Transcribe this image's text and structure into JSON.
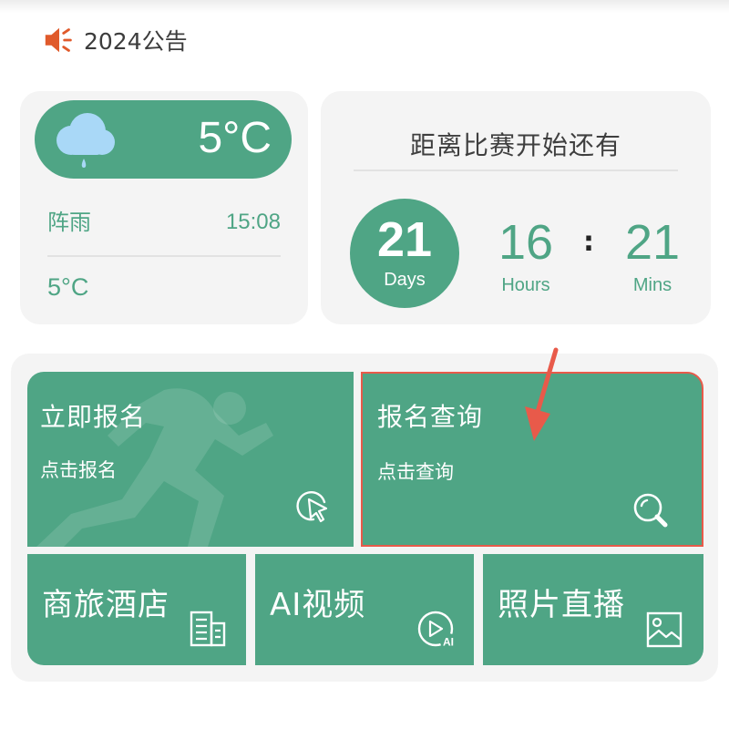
{
  "notice": {
    "text": "2024公告",
    "icon": "speaker-icon"
  },
  "weather": {
    "icon": "cloud-rain-icon",
    "temperature": "5°C",
    "condition": "阵雨",
    "time": "15:08",
    "temperature_secondary": "5°C"
  },
  "countdown": {
    "title": "距离比赛开始还有",
    "days": "21",
    "days_label": "Days",
    "hours": "16",
    "hours_label": "Hours",
    "separator": ":",
    "mins": "21",
    "mins_label": "Mins"
  },
  "tiles": {
    "register": {
      "title": "立即报名",
      "subtitle": "点击报名",
      "icon": "pointer-click-icon"
    },
    "query": {
      "title": "报名查询",
      "subtitle": "点击查询",
      "icon": "search-icon"
    },
    "hotel": {
      "title": "商旅酒店",
      "icon": "building-icon"
    },
    "video": {
      "title": "AI视频",
      "icon": "ai-play-icon",
      "badge": "AI"
    },
    "photo": {
      "title": "照片直播",
      "icon": "image-icon"
    }
  },
  "colors": {
    "accent": "#4fa585",
    "highlight": "#e85a4a",
    "card_bg": "#f4f4f4",
    "speaker": "#e05a2b"
  }
}
